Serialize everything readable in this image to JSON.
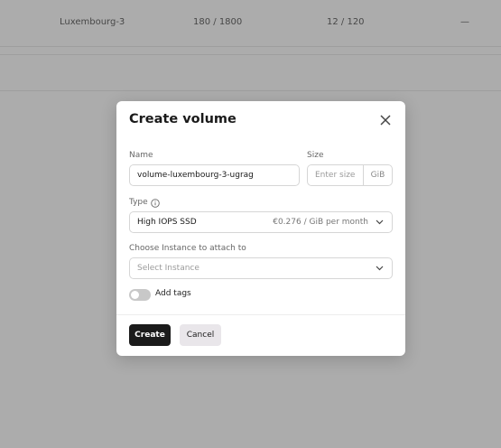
{
  "background": {
    "table_row": {
      "name": "Luxembourg-3",
      "col2": "180 / 1800",
      "col3": "12 / 120",
      "col4": "—"
    }
  },
  "modal": {
    "title": "Create volume",
    "name": {
      "label": "Name",
      "value": "volume-luxembourg-3-ugrag"
    },
    "size": {
      "label": "Size",
      "placeholder": "Enter size",
      "unit": "GiB"
    },
    "type": {
      "label": "Type",
      "value": "High IOPS SSD",
      "price": "€0.276 / GiB per month"
    },
    "instance": {
      "label": "Choose Instance to attach to",
      "placeholder": "Select Instance"
    },
    "tags": {
      "label": "Add tags",
      "enabled": false
    },
    "buttons": {
      "create": "Create",
      "cancel": "Cancel"
    }
  },
  "colors": {
    "primary_button": "#1b1b1b",
    "secondary_button": "#e9e6ea",
    "overlay": "rgba(90,90,90,0.5)"
  },
  "icons": [
    "close-icon",
    "info-icon",
    "chevron-down-icon"
  ]
}
